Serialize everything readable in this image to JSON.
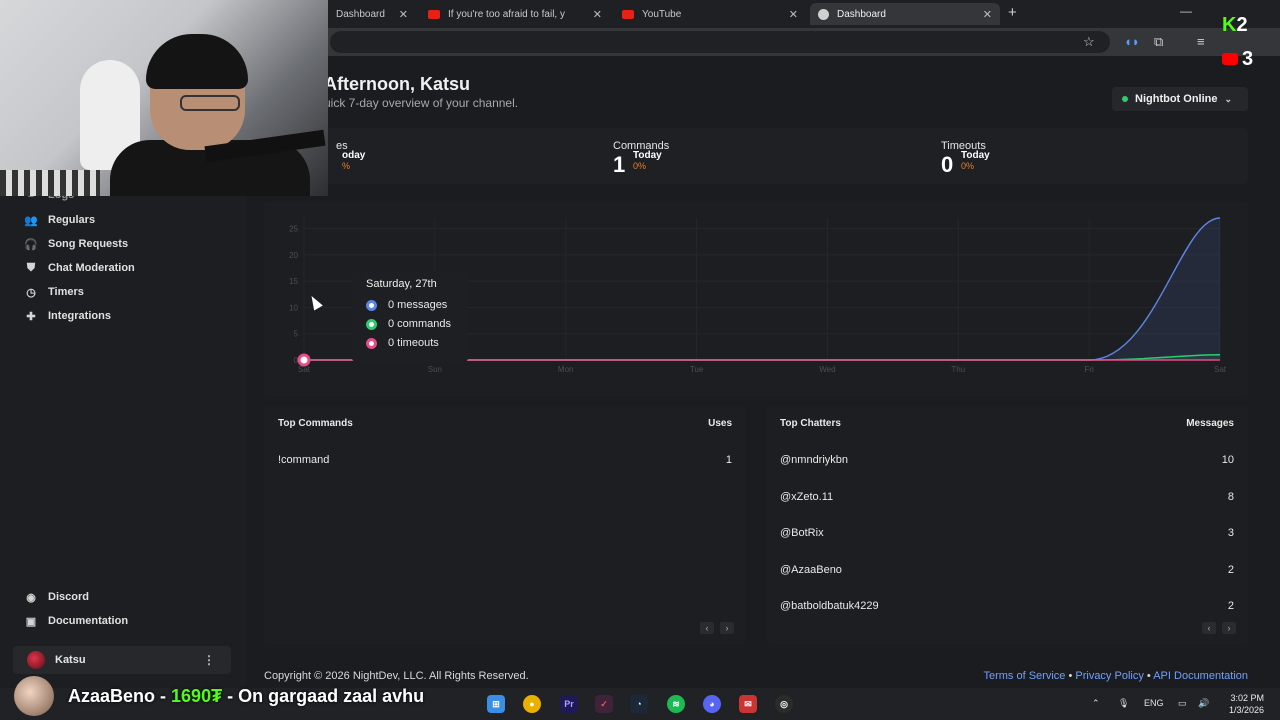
{
  "browser": {
    "tabs": [
      {
        "label": "Dashboard",
        "favicon": "nightbot-icon"
      },
      {
        "label": "If you're too afraid to fail, y",
        "favicon": "youtube-icon"
      },
      {
        "label": "YouTube",
        "favicon": "youtube-icon"
      },
      {
        "label": "Dashboard",
        "favicon": "nightbot-icon",
        "active": true
      }
    ],
    "new_tab": "+"
  },
  "sidebar": {
    "items": [
      {
        "label": "Logs",
        "icon": "list-icon"
      },
      {
        "label": "Regulars",
        "icon": "users-icon"
      },
      {
        "label": "Song Requests",
        "icon": "headphones-icon"
      },
      {
        "label": "Chat Moderation",
        "icon": "shield-icon"
      },
      {
        "label": "Timers",
        "icon": "clock-icon"
      },
      {
        "label": "Integrations",
        "icon": "puzzle-icon"
      }
    ],
    "bottom": [
      {
        "label": "Discord",
        "icon": "discord-icon"
      },
      {
        "label": "Documentation",
        "icon": "book-icon"
      }
    ],
    "user": {
      "name": "Katsu"
    }
  },
  "header": {
    "greeting": "Afternoon, Katsu",
    "subtitle": "uick 7-day overview of your channel.",
    "nightbot_status": "Nightbot Online"
  },
  "stats": [
    {
      "label": "es",
      "value": "",
      "today": "oday",
      "pct": "%"
    },
    {
      "label": "Commands",
      "value": "1",
      "today": "Today",
      "pct": "0%"
    },
    {
      "label": "Timeouts",
      "value": "0",
      "today": "Today",
      "pct": "0%"
    }
  ],
  "chart_data": {
    "type": "area",
    "x": [
      "Sat",
      "Sun",
      "Mon",
      "Tue",
      "Wed",
      "Thu",
      "Fri",
      "Sat"
    ],
    "y_ticks": [
      0,
      5,
      10,
      15,
      20,
      25
    ],
    "ylim": [
      0,
      27
    ],
    "series": [
      {
        "name": "messages",
        "color": "#5b86e5",
        "values": [
          0,
          0,
          0,
          0,
          0,
          0,
          0,
          27
        ]
      },
      {
        "name": "commands",
        "color": "#2ecc71",
        "values": [
          0,
          0,
          0,
          0,
          0,
          0,
          0,
          1
        ]
      },
      {
        "name": "timeouts",
        "color": "#e84b8a",
        "values": [
          0,
          0,
          0,
          0,
          0,
          0,
          0,
          0
        ]
      }
    ],
    "tooltip": {
      "title": "Saturday, 27th",
      "rows": [
        "0 messages",
        "0 commands",
        "0 timeouts"
      ]
    }
  },
  "top_commands": {
    "title": "Top Commands",
    "col": "Uses",
    "rows": [
      {
        "name": "!command",
        "value": "1"
      }
    ]
  },
  "top_chatters": {
    "title": "Top Chatters",
    "col": "Messages",
    "rows": [
      {
        "name": "@nmndriykbn",
        "value": "10"
      },
      {
        "name": "@xZeto.11",
        "value": "8"
      },
      {
        "name": "@BotRix",
        "value": "3"
      },
      {
        "name": "@AzaaBeno",
        "value": "2"
      },
      {
        "name": "@batboldbatuk4229",
        "value": "2"
      }
    ]
  },
  "footer": {
    "copyright": "Copyright © 2026 NightDev, LLC. All Rights Reserved.",
    "links": [
      "Terms of Service",
      "Privacy Policy",
      "API Documentation"
    ],
    "separator": "•"
  },
  "overlay": {
    "kick_count": "2",
    "youtube_count": "3",
    "alert_name": "AzaaBeno - ",
    "alert_amount": "1690₮",
    "alert_message": " - On gargaad zaal avhu"
  },
  "taskbar": {
    "lang": "ENG",
    "time": "3:02 PM",
    "date": "1/3/2026",
    "apps": [
      "windows-icon",
      "chrome-icon",
      "premiere-icon",
      "app-icon",
      "steam-icon",
      "spotify-icon",
      "discord-icon",
      "mail-icon",
      "obs-icon"
    ]
  }
}
